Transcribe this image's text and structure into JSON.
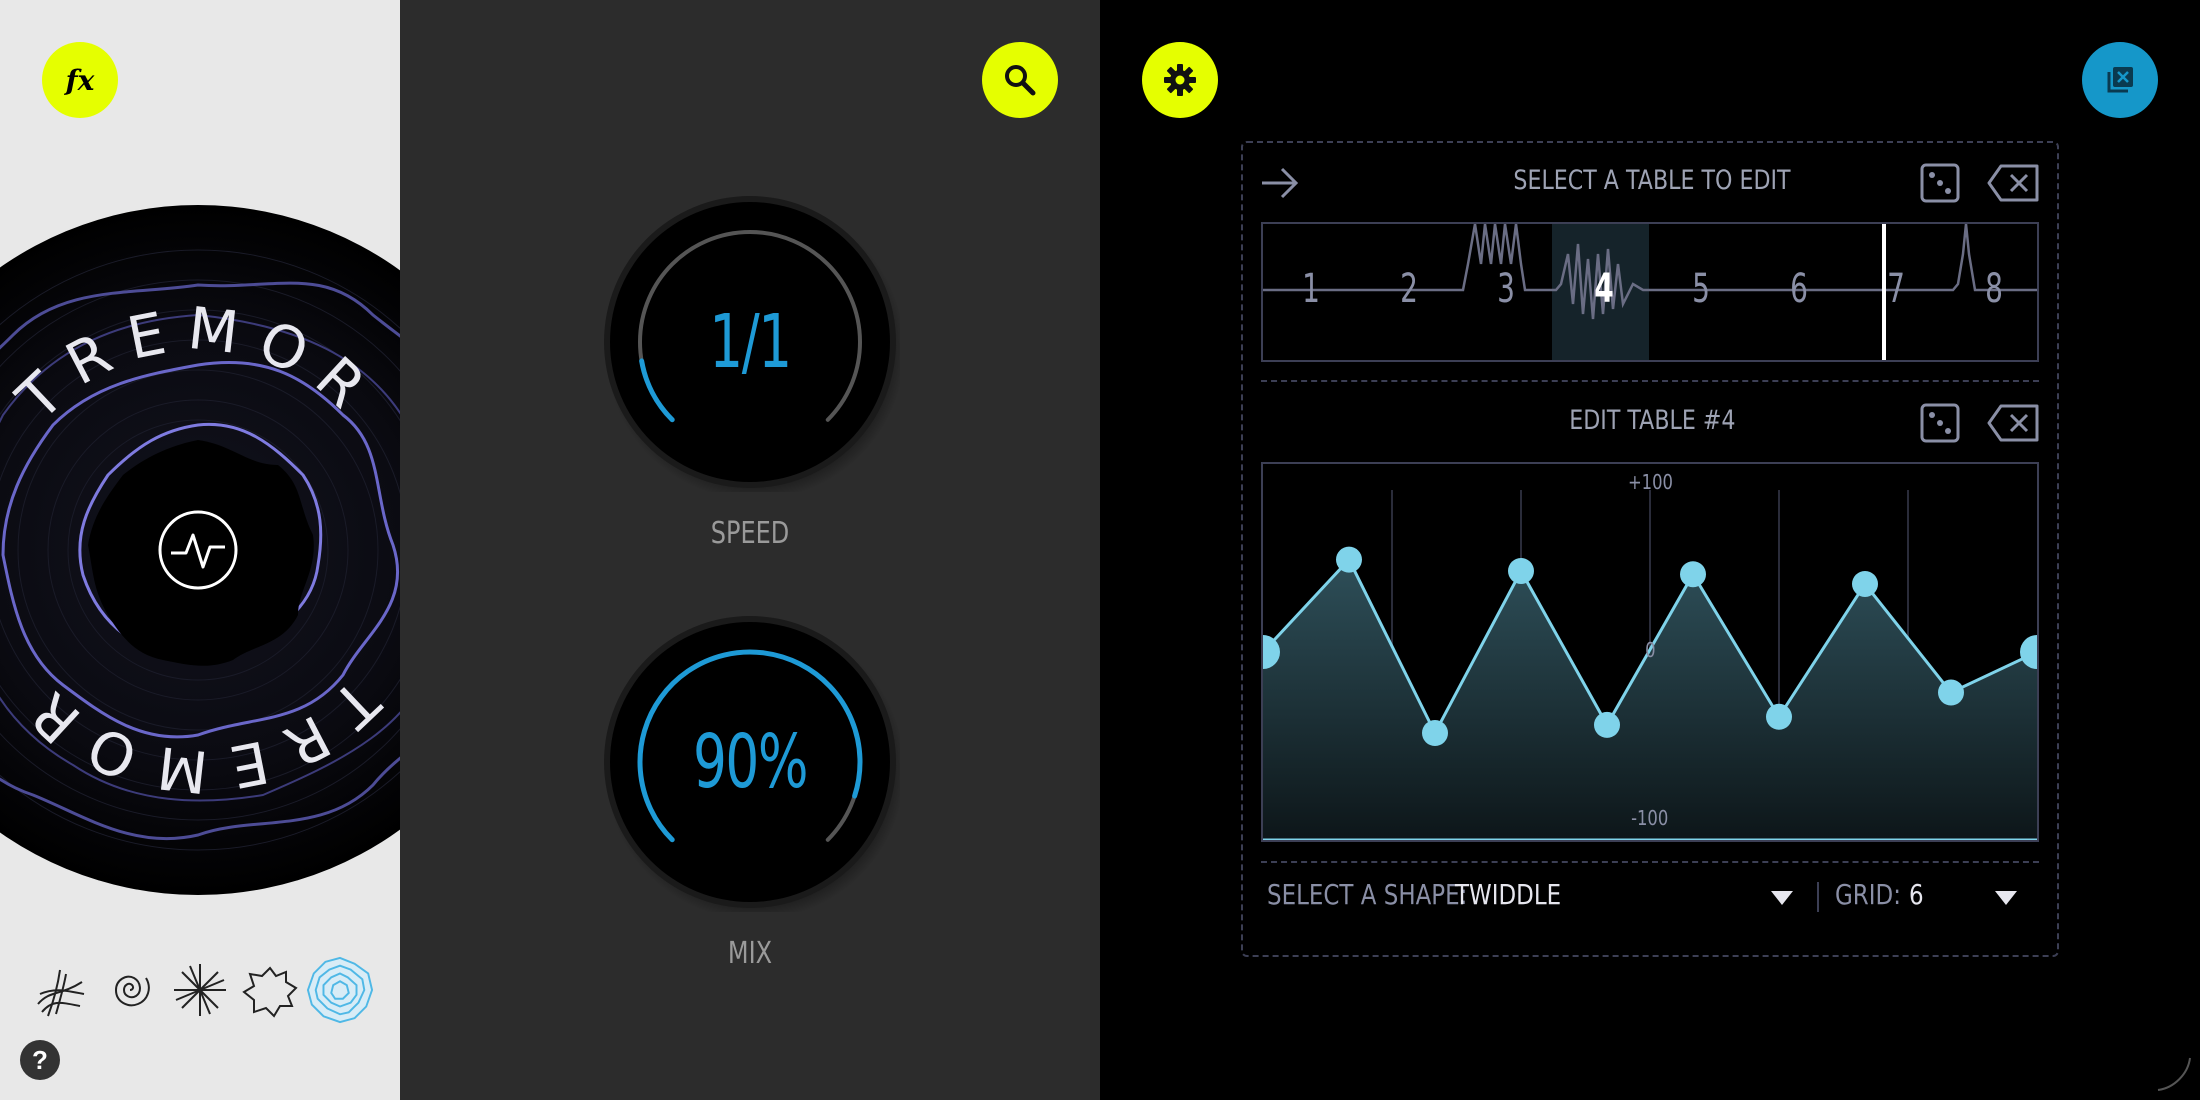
{
  "left_panel": {
    "fx_button": "fx",
    "disc_title_top": "TREMOR",
    "disc_title_bottom": "TREMOR",
    "help_button": "?",
    "presets": [
      "seaweed",
      "spiral",
      "starburst",
      "cloud",
      "ripple"
    ],
    "selected_preset": "ripple"
  },
  "middle_panel": {
    "speed": {
      "value": "1/1",
      "label": "SPEED",
      "level": 0.13
    },
    "mix": {
      "value": "90%",
      "label": "MIX",
      "level": 0.9
    }
  },
  "right_panel": {
    "select_table_title": "SELECT A TABLE TO EDIT",
    "tables": [
      "1",
      "2",
      "3",
      "4",
      "5",
      "6",
      "7",
      "8"
    ],
    "selected_table": "4",
    "playhead_table": "7",
    "edit_title": "EDIT TABLE #4",
    "axis_top": "+100",
    "axis_mid": "0",
    "axis_bottom": "-100",
    "points": [
      0,
      57,
      -50,
      50,
      -45,
      48,
      -40,
      42,
      -25,
      0
    ],
    "shape_label": "SELECT A SHAPE:",
    "shape_value": "TWIDDLE",
    "grid_label": "GRID:",
    "grid_value": "6"
  },
  "colors": {
    "accent_yellow": "#e5ff00",
    "accent_blue": "#1e9ad6",
    "wave_cyan": "#7fd3ea",
    "disc_ring": "#7a78d6"
  }
}
